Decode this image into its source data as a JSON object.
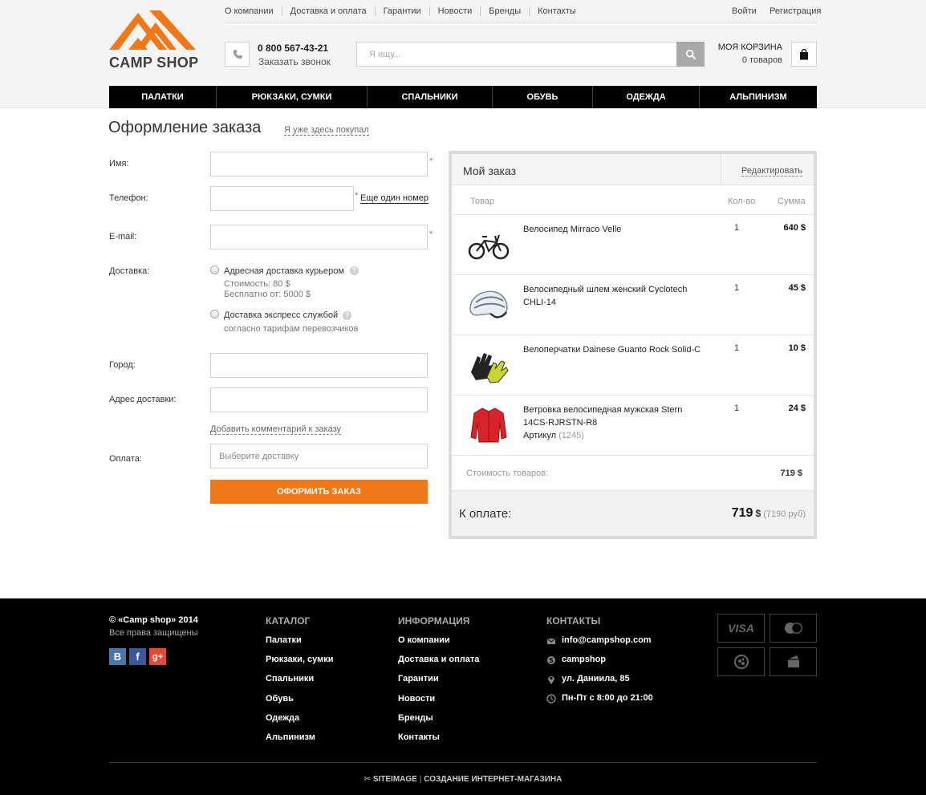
{
  "header": {
    "logo_text": "CAMP SHOP",
    "top_links": [
      "О компании",
      "Доставка и оплата",
      "Гарантии",
      "Новости",
      "Бренды",
      "Контакты"
    ],
    "login": "Войти",
    "register": "Регистрация",
    "phone": "0 800 567-43-21",
    "callback": "Заказать звонок",
    "search_placeholder": "Я ищу...",
    "cart_title": "МОЯ КОРЗИНА",
    "cart_count": "0 товаров"
  },
  "main_nav": [
    "ПАЛАТКИ",
    "РЮКЗАКИ, СУМКИ",
    "СПАЛЬНИКИ",
    "ОБУВЬ",
    "ОДЕЖДА",
    "АЛЬПИНИЗМ"
  ],
  "form": {
    "title": "Оформление заказа",
    "already_bought": "Я уже здесь покупал",
    "name_label": "Имя:",
    "phone_label": "Телефон:",
    "another_number": "Еще один номер",
    "email_label": "E-mail:",
    "delivery_label": "Доставка:",
    "delivery_options": [
      {
        "label": "Адресная доставка курьером",
        "sub1": "Стоимость: 80 $",
        "sub2": "Бесплатно от: 5000 $"
      },
      {
        "label": "Доставка экспресс службой",
        "sub1": "согласно тарифам перевозчиков",
        "sub2": ""
      }
    ],
    "city_label": "Город:",
    "address_label": "Адрес доставки:",
    "add_comment": "Добавить комментарий к заказу",
    "payment_label": "Оплата:",
    "payment_placeholder": "Выберите доставку",
    "submit": "ОФОРМИТЬ ЗАКАЗ",
    "required_mark": "*"
  },
  "order": {
    "title": "Мой заказ",
    "edit": "Редактировать",
    "col_product": "Товар",
    "col_qty": "Кол-во",
    "col_sum": "Сумма",
    "items": [
      {
        "name": "Велосипед Mirraco Velle",
        "qty": "1",
        "sum": "640 $",
        "icon": "bicycle-icon"
      },
      {
        "name": "Велосипедный шлем женский Cyclotech CHLI-14",
        "qty": "1",
        "sum": "45 $",
        "icon": "helmet-icon"
      },
      {
        "name": "Велоперчатки Dainese Guanto Rock Solid-C",
        "qty": "1",
        "sum": "10 $",
        "icon": "gloves-icon"
      },
      {
        "name": "Ветровка велосипедная мужская Stern 14CS-RJRSTN-R8",
        "art_label": "Артикул",
        "art_value": "(1245)",
        "qty": "1",
        "sum": "24 $",
        "icon": "jacket-icon"
      }
    ],
    "subtotal_label": "Стоимость товаров:",
    "subtotal_value": "719 $",
    "total_label": "К оплате:",
    "total_value": "719",
    "total_currency": "$",
    "total_rub": "(7190 руб)"
  },
  "footer": {
    "copyright": "© «Camp shop» 2014",
    "rights": "Все права защищены",
    "social": [
      "B",
      "f",
      "g+"
    ],
    "catalog_title": "КАТАЛОГ",
    "catalog": [
      "Палатки",
      "Рюкзаки, сумки",
      "Спальники",
      "Обувь",
      "Одежда",
      "Альпинизм"
    ],
    "info_title": "ИНФОРМАЦИЯ",
    "info": [
      "О компании",
      "Доставка и оплата",
      "Гарантии",
      "Новости",
      "Бренды",
      "Контакты"
    ],
    "contacts_title": "КОНТАКТЫ",
    "contacts": [
      "info@campshop.com",
      "campshop",
      "ул. Даниила, 85",
      "Пн-Пт с 8:00 до 21:00"
    ],
    "payment_icons": [
      "visa-icon",
      "mastercard-icon",
      "webmoney-icon",
      "wallet-icon"
    ],
    "visa_text": "VISA",
    "credit_brand": "SITEIMAGE",
    "credit_text": "СОЗДАНИЕ ИНТЕРНЕТ-МАГАЗИНА",
    "accent_color": "#f07819"
  }
}
